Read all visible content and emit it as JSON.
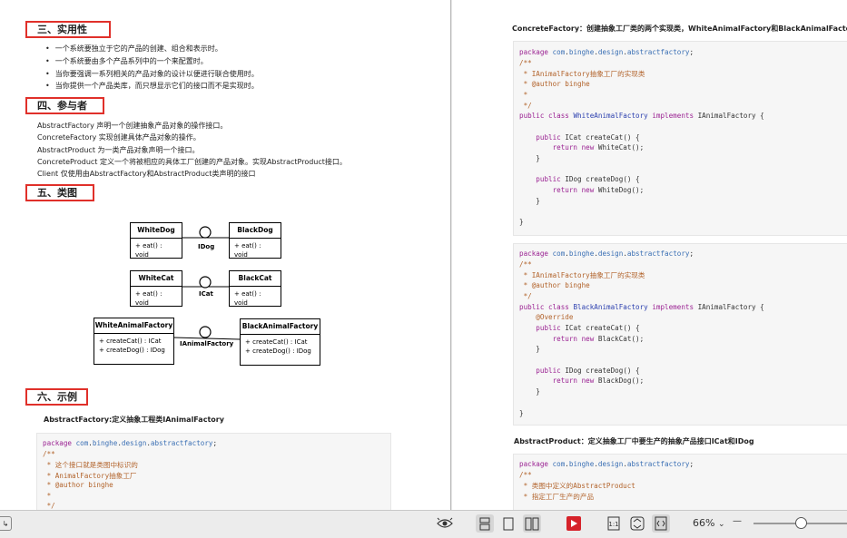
{
  "left_page": {
    "sec3": {
      "title": "三、实用性",
      "bullets": [
        "一个系统要独立于它的产品的创建、组合和表示时。",
        "一个系统要由多个产品系列中的一个来配置时。",
        "当你要强调一系列相关的产品对象的设计以便进行联合使用时。",
        "当你提供一个产品类库，而只想显示它们的接口而不是实现时。"
      ]
    },
    "sec4": {
      "title": "四、参与者",
      "lines": [
        "AbstractFactory 声明一个创建抽象产品对象的操作接口。",
        "ConcreteFactory 实现创建具体产品对象的操作。",
        "AbstractProduct 为一类产品对象声明一个接口。",
        "ConcreteProduct 定义一个将被相应的具体工厂创建的产品对象。实现AbstractProduct接口。",
        "Client 仅使用由AbstractFactory和AbstractProduct类声明的接口"
      ]
    },
    "sec5": {
      "title": "五、类图"
    },
    "uml": {
      "white_dog": {
        "name": "WhiteDog",
        "op": "+ eat() : void"
      },
      "black_dog": {
        "name": "BlackDog",
        "op": "+ eat() : void"
      },
      "idog": "IDog",
      "white_cat": {
        "name": "WhiteCat",
        "op": "+ eat() : void"
      },
      "black_cat": {
        "name": "BlackCat",
        "op": "+ eat() : void"
      },
      "icat": "ICat",
      "white_factory": {
        "name": "WhiteAnimalFactory",
        "op1": "+ createCat() : ICat",
        "op2": "+ createDog() : IDog"
      },
      "black_factory": {
        "name": "BlackAnimalFactory",
        "op1": "+ createCat() : ICat",
        "op2": "+ createDog() : IDog"
      },
      "ifactory": "IAnimalFactory"
    },
    "sec6": {
      "title": "六、示例",
      "caption": "AbstractFactory:定义抽象工程类IAnimalFactory"
    },
    "code": [
      [
        [
          "kw",
          "package "
        ],
        [
          "pk",
          "com"
        ],
        [
          "",
          "."
        ],
        [
          "pk",
          "binghe"
        ],
        [
          "",
          "."
        ],
        [
          "pk",
          "design"
        ],
        [
          "",
          "."
        ],
        [
          "pk",
          "abstractfactory"
        ],
        [
          "",
          ";"
        ]
      ],
      [
        [
          "cm",
          "/**"
        ]
      ],
      [
        [
          "cm",
          " * 这个接口就是类图中标识的"
        ]
      ],
      [
        [
          "cm",
          " * AnimalFactory抽象工厂"
        ]
      ],
      [
        [
          "cm",
          " * @author binghe"
        ]
      ],
      [
        [
          "cm",
          " *"
        ]
      ],
      [
        [
          "cm",
          " */"
        ]
      ]
    ]
  },
  "right_page": {
    "caption1": "ConcreteFactory：创建抽象工厂类的两个实现类，WhiteAnimalFactory和BlackAnimalFacto",
    "code1": [
      [
        [
          "kw",
          "package "
        ],
        [
          "pk",
          "com"
        ],
        [
          "",
          "."
        ],
        [
          "pk",
          "binghe"
        ],
        [
          "",
          "."
        ],
        [
          "pk",
          "design"
        ],
        [
          "",
          "."
        ],
        [
          "pk",
          "abstractfactory"
        ],
        [
          "",
          ";"
        ]
      ],
      [
        [
          "cm",
          "/**"
        ]
      ],
      [
        [
          "cm",
          " * IAnimalFactory抽象工厂的实现类"
        ]
      ],
      [
        [
          "cm",
          " * @author binghe"
        ]
      ],
      [
        [
          "cm",
          " *"
        ]
      ],
      [
        [
          "cm",
          " */"
        ]
      ],
      [
        [
          "kw",
          "public class "
        ],
        [
          "cls",
          "WhiteAnimalFactory "
        ],
        [
          "kw",
          "implements "
        ],
        [
          "",
          "IAnimalFactory {"
        ]
      ],
      [],
      [
        [
          "",
          "    "
        ],
        [
          "kw",
          "public "
        ],
        [
          "",
          "ICat createCat() {"
        ]
      ],
      [
        [
          "",
          "        "
        ],
        [
          "kw",
          "return new "
        ],
        [
          "",
          "WhiteCat();"
        ]
      ],
      [
        [
          "",
          "    }"
        ]
      ],
      [],
      [
        [
          "",
          "    "
        ],
        [
          "kw",
          "public "
        ],
        [
          "",
          "IDog createDog() {"
        ]
      ],
      [
        [
          "",
          "        "
        ],
        [
          "kw",
          "return new "
        ],
        [
          "",
          "WhiteDog();"
        ]
      ],
      [
        [
          "",
          "    }"
        ]
      ],
      [],
      [
        [
          "",
          "}"
        ]
      ]
    ],
    "code2": [
      [
        [
          "kw",
          "package "
        ],
        [
          "pk",
          "com"
        ],
        [
          "",
          "."
        ],
        [
          "pk",
          "binghe"
        ],
        [
          "",
          "."
        ],
        [
          "pk",
          "design"
        ],
        [
          "",
          "."
        ],
        [
          "pk",
          "abstractfactory"
        ],
        [
          "",
          ";"
        ]
      ],
      [
        [
          "cm",
          "/**"
        ]
      ],
      [
        [
          "cm",
          " * IAnimalFactory抽象工厂的实现类"
        ]
      ],
      [
        [
          "cm",
          " * @author binghe"
        ]
      ],
      [
        [
          "cm",
          " */"
        ]
      ],
      [
        [
          "kw",
          "public class "
        ],
        [
          "cls",
          "BlackAnimalFactory "
        ],
        [
          "kw",
          "implements "
        ],
        [
          "",
          "IAnimalFactory {"
        ]
      ],
      [
        [
          "",
          "    "
        ],
        [
          "cm",
          "@Override"
        ]
      ],
      [
        [
          "",
          "    "
        ],
        [
          "kw",
          "public "
        ],
        [
          "",
          "ICat createCat() {"
        ]
      ],
      [
        [
          "",
          "        "
        ],
        [
          "kw",
          "return new "
        ],
        [
          "",
          "BlackCat();"
        ]
      ],
      [
        [
          "",
          "    }"
        ]
      ],
      [],
      [
        [
          "",
          "    "
        ],
        [
          "kw",
          "public "
        ],
        [
          "",
          "IDog createDog() {"
        ]
      ],
      [
        [
          "",
          "        "
        ],
        [
          "kw",
          "return new "
        ],
        [
          "",
          "BlackDog();"
        ]
      ],
      [
        [
          "",
          "    }"
        ]
      ],
      [],
      [
        [
          "",
          "}"
        ]
      ]
    ],
    "caption2": "AbstractProduct：定义抽象工厂中要生产的抽象产品接口ICat和IDog",
    "code3": [
      [
        [
          "kw",
          "package "
        ],
        [
          "pk",
          "com"
        ],
        [
          "",
          "."
        ],
        [
          "pk",
          "binghe"
        ],
        [
          "",
          "."
        ],
        [
          "pk",
          "design"
        ],
        [
          "",
          "."
        ],
        [
          "pk",
          "abstractfactory"
        ],
        [
          "",
          ";"
        ]
      ],
      [
        [
          "cm",
          "/**"
        ]
      ],
      [
        [
          "cm",
          " * 类图中定义的AbstractProduct"
        ]
      ],
      [
        [
          "cm",
          " * 指定工厂生产的产品"
        ]
      ]
    ]
  },
  "toolbar": {
    "zoom": "66%",
    "zoom_arrow": "⌄",
    "zoom_minus": "—",
    "zoom_fraction": 0.66,
    "icons": [
      "exit-icon",
      "eye-icon",
      "single-page-icon",
      "page-icon",
      "two-page-icon",
      "slideshow-icon",
      "actual-size-icon",
      "fit-page-icon",
      "fit-width-icon"
    ]
  }
}
